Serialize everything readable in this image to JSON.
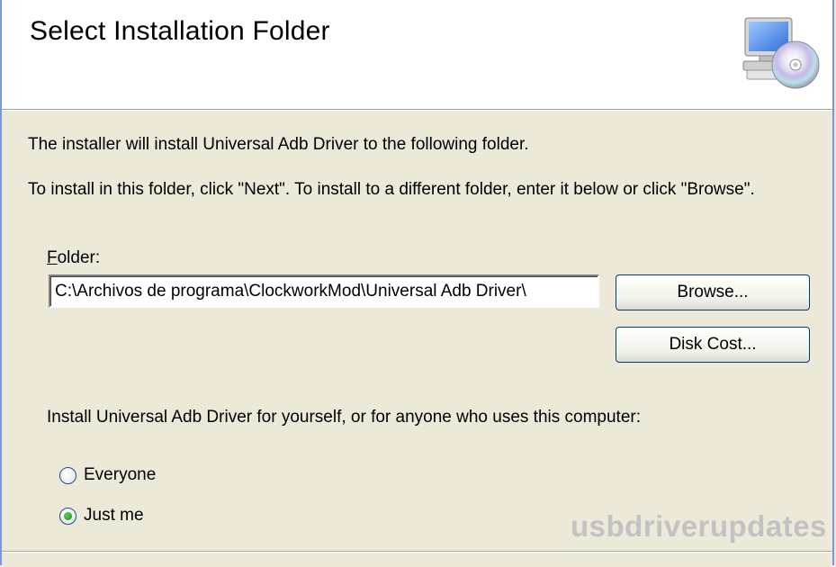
{
  "header": {
    "title": "Select Installation Folder",
    "icon": "computer-cd-icon"
  },
  "body": {
    "desc_line1": "The installer will install Universal Adb Driver to the following folder.",
    "desc_line2": "To install in this folder, click \"Next\". To install to a different folder, enter it below or click \"Browse\"."
  },
  "folder": {
    "label_hotkey": "F",
    "label_rest": "older:",
    "value": "C:\\Archivos de programa\\ClockworkMod\\Universal Adb Driver\\"
  },
  "buttons": {
    "browse": "Browse...",
    "disk_cost": "Disk Cost..."
  },
  "scope": {
    "question": "Install Universal Adb Driver for yourself, or for anyone who uses this computer:",
    "options": [
      {
        "label": "Everyone",
        "selected": false
      },
      {
        "label": "Just me",
        "selected": true
      }
    ]
  },
  "watermark": "usbdriverupdates",
  "colors": {
    "dialog_bg": "#ece9d8",
    "banner_bg": "#ffffff",
    "frame_border": "#7a96df",
    "button_border": "#003c74"
  }
}
